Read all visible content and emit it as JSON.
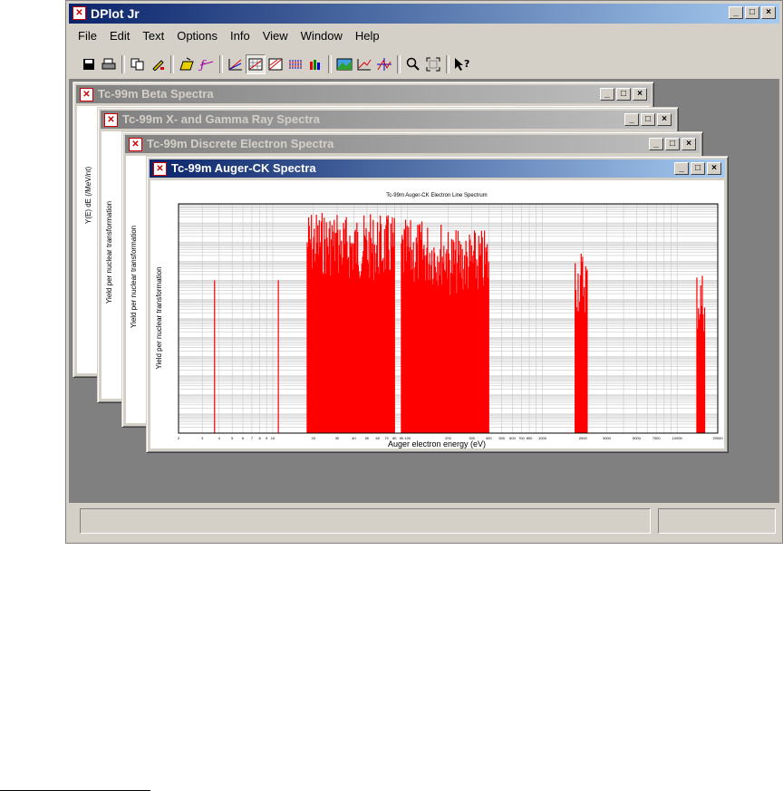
{
  "app": {
    "title": "DPlot Jr",
    "menu": [
      "File",
      "Edit",
      "Text",
      "Options",
      "Info",
      "View",
      "Window",
      "Help"
    ]
  },
  "toolbar": {
    "icons": [
      "save-icon",
      "print-icon",
      "copy-icon",
      "paste-icon",
      "open-icon",
      "formula-icon",
      "line-plot-icon",
      "grid-plot-icon",
      "contour-plot-icon",
      "dot-plot-icon",
      "bar-chart-icon",
      "surface-icon",
      "axis-icon",
      "crosshair-icon",
      "zoom-icon",
      "fit-icon",
      "help-pointer-icon"
    ]
  },
  "windows": [
    {
      "title": "Tc-99m Beta Spectra",
      "ylabel": "Y(E) dE (/MeV/nt)"
    },
    {
      "title": "Tc-99m X- and Gamma Ray Spectra",
      "ylabel": "Yield per nuclear transformation"
    },
    {
      "title": "Tc-99m Discrete Electron Spectra",
      "ylabel": "Yield per nuclear transformation"
    },
    {
      "title": "Tc-99m Auger-CK Spectra",
      "ylabel": "Yield per nuclear transformation"
    }
  ],
  "chart_data": {
    "type": "bar",
    "title": "Tc-99m Auger-CK Electron Line Spectrum",
    "xlabel": "Auger electron energy (eV)",
    "ylabel": "Yield per nuclear transformation",
    "xscale": "log",
    "yscale": "log",
    "xlim": [
      2,
      20000
    ],
    "ylim": [
      1e-12,
      1
    ],
    "grid": true,
    "color": "#ff0000",
    "x_tick_labels": [
      "2",
      "3",
      "4",
      "5",
      "6",
      "7",
      "8",
      "9",
      "10",
      "20",
      "30",
      "40",
      "50",
      "60",
      "70",
      "80",
      "90",
      "100",
      "200",
      "300",
      "400",
      "500",
      "600",
      "700",
      "800",
      "1000",
      "2000",
      "3000",
      "5000",
      "7000",
      "10000",
      "20000"
    ],
    "clusters": [
      {
        "x_range": [
          3.7,
          3.7
        ],
        "peak": 0.0001
      },
      {
        "x_range": [
          11,
          11
        ],
        "peak": 0.0001
      },
      {
        "x_range": [
          18,
          30
        ],
        "peak": 0.5
      },
      {
        "x_range": [
          30,
          80
        ],
        "peak": 0.3
      },
      {
        "x_range": [
          90,
          200
        ],
        "peak": 0.15
      },
      {
        "x_range": [
          200,
          400
        ],
        "peak": 0.05
      },
      {
        "x_range": [
          1750,
          2150
        ],
        "peak": 0.005
      },
      {
        "x_range": [
          14000,
          16000
        ],
        "peak": 0.0005
      }
    ]
  }
}
